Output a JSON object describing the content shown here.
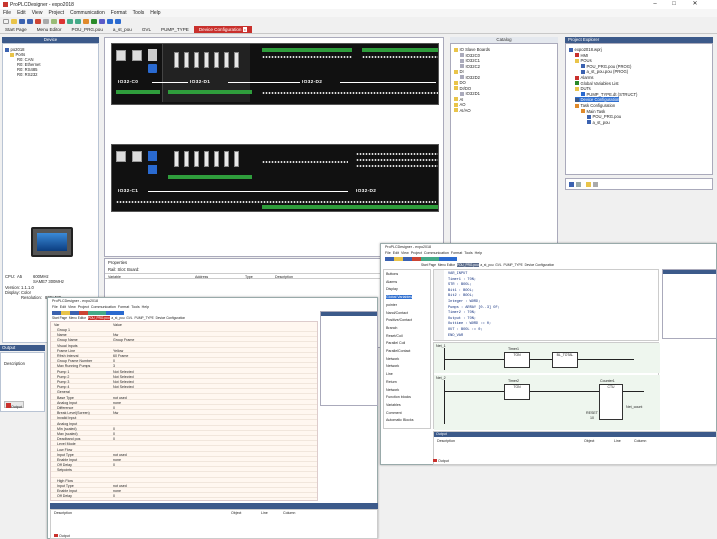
{
  "window": {
    "title": "ProPLCDesigner - expo2018",
    "controls": [
      "–",
      "□",
      "✕"
    ]
  },
  "menu": [
    "File",
    "Edit",
    "View",
    "Project",
    "Communication",
    "Format",
    "Tools",
    "Help"
  ],
  "tabs": [
    {
      "label": "Start Page",
      "active": false
    },
    {
      "label": "Menu Editor",
      "active": false
    },
    {
      "label": "POU_PRG.pou",
      "active": false
    },
    {
      "label": "a_st_pou",
      "active": false
    },
    {
      "label": "GVL",
      "active": false
    },
    {
      "label": "PUMP_TYPE",
      "active": false
    },
    {
      "label": "Device Configuration",
      "active": true
    }
  ],
  "device_panel": {
    "header": "Device",
    "tree": [
      {
        "label": "po2018",
        "indent": 0
      },
      {
        "label": "Ports",
        "indent": 1
      },
      {
        "label": "R0: CAN",
        "indent": 2
      },
      {
        "label": "R0: Ethernet",
        "indent": 2
      },
      {
        "label": "R0: RS485",
        "indent": 2
      },
      {
        "label": "R0: RS232",
        "indent": 2
      }
    ],
    "specs": [
      {
        "k": "CPU:",
        "v1": "A5",
        "v2": "600MHz"
      },
      {
        "k": "",
        "v1": "",
        "v2": "SAME7 300MHz"
      },
      {
        "k": "Version:",
        "v1": "1.1.1.0",
        "v2": ""
      },
      {
        "k": "Display:",
        "v1": "Color",
        "v2": ""
      },
      {
        "k": "",
        "v1": "Resolution:",
        "v2": "800x480"
      }
    ]
  },
  "canvas": {
    "rack1_labels": [
      "IO32-C0",
      "IO32-D1",
      "IO32-D2"
    ],
    "rack2_labels": [
      "IO32-C1",
      "IO32-D2"
    ]
  },
  "properties": {
    "header": "Properties",
    "path": "Rail: Slot: Board:",
    "columns": [
      "Variable",
      "Address",
      "Type",
      "Description"
    ]
  },
  "catalog": {
    "header": "Catalog",
    "items": [
      {
        "label": "IO Slave Boards",
        "indent": 0
      },
      {
        "label": "IO32C0",
        "indent": 1
      },
      {
        "label": "IO32C1",
        "indent": 1
      },
      {
        "label": "IO32C2",
        "indent": 1
      },
      {
        "label": "DI",
        "indent": 0
      },
      {
        "label": "IO32D2",
        "indent": 1
      },
      {
        "label": "DO",
        "indent": 0
      },
      {
        "label": "DI/DO",
        "indent": 0
      },
      {
        "label": "IO32D1",
        "indent": 1
      },
      {
        "label": "AI",
        "indent": 0
      },
      {
        "label": "AO",
        "indent": 0
      },
      {
        "label": "AI/AO",
        "indent": 0
      }
    ]
  },
  "project_explorer": {
    "header": "Project Explorer",
    "items": [
      {
        "label": "expo2018.wprj",
        "indent": 0,
        "sel": false
      },
      {
        "label": "HMI",
        "indent": 1,
        "sel": false
      },
      {
        "label": "POUs",
        "indent": 1,
        "sel": false
      },
      {
        "label": "POU_PRG.pou (PROG)",
        "indent": 2,
        "sel": false
      },
      {
        "label": "a_st_pou.pou (PROG)",
        "indent": 2,
        "sel": false
      },
      {
        "label": "Alarms",
        "indent": 1,
        "sel": false
      },
      {
        "label": "Global Variables List",
        "indent": 1,
        "sel": false
      },
      {
        "label": "DUTs",
        "indent": 1,
        "sel": false
      },
      {
        "label": "PUMP_TYPE.dt (STRUCT)",
        "indent": 2,
        "sel": false
      },
      {
        "label": "Device Configuration",
        "indent": 1,
        "sel": true
      },
      {
        "label": "Task Configuration",
        "indent": 1,
        "sel": false
      },
      {
        "label": "Main Task",
        "indent": 2,
        "sel": false
      },
      {
        "label": "POU_PRG.pou",
        "indent": 3,
        "sel": false
      },
      {
        "label": "a_st_pou",
        "indent": 3,
        "sel": false
      }
    ]
  },
  "output": {
    "header": "Output",
    "label": "Description",
    "tab": "Output"
  },
  "shot_left": {
    "title": "ProPLCDesigner - expo2018",
    "menu": [
      "File",
      "Edit",
      "View",
      "Project",
      "Communication",
      "Format",
      "Tools",
      "Help"
    ],
    "tabs": [
      "Start Page",
      "Menu Editor",
      "POU_PRG.pou",
      "a_st_pou",
      "GVL",
      "PUMP_TYPE",
      "Device Configuration"
    ],
    "grid_head": [
      "Var",
      "Value"
    ],
    "rows": [
      {
        "n": "Group 1",
        "v": ""
      },
      {
        "n": "Name",
        "v": "Nw"
      },
      {
        "n": "Group Name",
        "v": "Group Frame"
      },
      {
        "n": "Visual Inputs",
        "v": ""
      },
      {
        "n": "Frame Line",
        "v": "Yellow"
      },
      {
        "n": "Rfrsh Interval",
        "v": "60 Frame"
      },
      {
        "n": "Group Frame Number",
        "v": "0"
      },
      {
        "n": "Max Running Pumps",
        "v": "3"
      },
      {
        "n": "Pump 1",
        "v": "Not Selected"
      },
      {
        "n": "Pump 2",
        "v": "Not Selected"
      },
      {
        "n": "Pump 3",
        "v": "Not Selected"
      },
      {
        "n": "Pump 4",
        "v": "Not Selected"
      },
      {
        "n": "General",
        "v": ""
      },
      {
        "n": "Base Type",
        "v": "not used"
      },
      {
        "n": "Analog Input",
        "v": "none"
      },
      {
        "n": "Difference",
        "v": "0"
      },
      {
        "n": "Break Level(Screen)",
        "v": "Nw"
      },
      {
        "n": "Invalid Input",
        "v": ""
      },
      {
        "n": "Analog Input",
        "v": ""
      },
      {
        "n": "Min (scaled)",
        "v": "0"
      },
      {
        "n": "Max (scaled)",
        "v": "0"
      },
      {
        "n": "Deadband pos",
        "v": "0"
      },
      {
        "n": "Level Mode",
        "v": ""
      },
      {
        "n": "Low Flow",
        "v": ""
      },
      {
        "n": "Input Type",
        "v": "not used"
      },
      {
        "n": "Enable Input",
        "v": "none"
      },
      {
        "n": "Off Delay",
        "v": "0"
      },
      {
        "n": "Setpoints",
        "v": ""
      },
      {
        "n": "",
        "v": ""
      },
      {
        "n": "High Flow",
        "v": ""
      },
      {
        "n": "Input Type",
        "v": "not used"
      },
      {
        "n": "Enable Input",
        "v": "none"
      },
      {
        "n": "Off Delay",
        "v": "0"
      }
    ],
    "output_cols": [
      "Description",
      "Object",
      "Line",
      "Column"
    ],
    "output_tab": "Output"
  },
  "shot_right": {
    "title": "ProPLCDesigner - expo2018",
    "menu": [
      "File",
      "Edit",
      "View",
      "Project",
      "Communication",
      "Format",
      "Tools",
      "Help"
    ],
    "tabs": [
      "Start Page",
      "Menu Editor",
      "POU_PRG.pou",
      "a_st_pou",
      "GVL",
      "PUMP_TYPE",
      "Device Configuration"
    ],
    "toolbox": [
      "Buttons",
      "Alarms",
      "Display",
      "Global Variables",
      "pointer",
      "Nand/Contact",
      "Positive/Contact",
      "Branch",
      "Reset/Coil",
      "Parallel Coil",
      "ParallelContact",
      "Network",
      "Network",
      "Line",
      "Return",
      "Network",
      "Function blocks",
      "Variables",
      "Comment",
      "Automatic Blocks"
    ],
    "code": [
      "VAR_INPUT",
      "   Timer1 : TON;",
      "   STR : BOOL;",
      "   Bit1 : BOOL;",
      "   Bit2 : BOOL;",
      "   Integer : WORD;",
      "   Pumps : ARRAY [0..3] OF;",
      "   Timer2 : TON;",
      "   Output : TON;",
      "   Outtime : WORD := 0;",
      "   OUT : BOOL := 0;",
      "END_VAR"
    ],
    "net1": {
      "label": "Net_1",
      "block": "Timer1",
      "type": "TON",
      "pin": "BL_TOTAL"
    },
    "net2": {
      "label": "Net_2",
      "block": "Timer2",
      "type": "TON",
      "counter": "Counter1",
      "ctype": "CTU",
      "reset": "RESET",
      "pv": "10",
      "cv": "Net_count"
    },
    "output_cols": [
      "Description",
      "Object",
      "Line",
      "Column"
    ],
    "output_label": "Output",
    "output_tab": "Output"
  }
}
